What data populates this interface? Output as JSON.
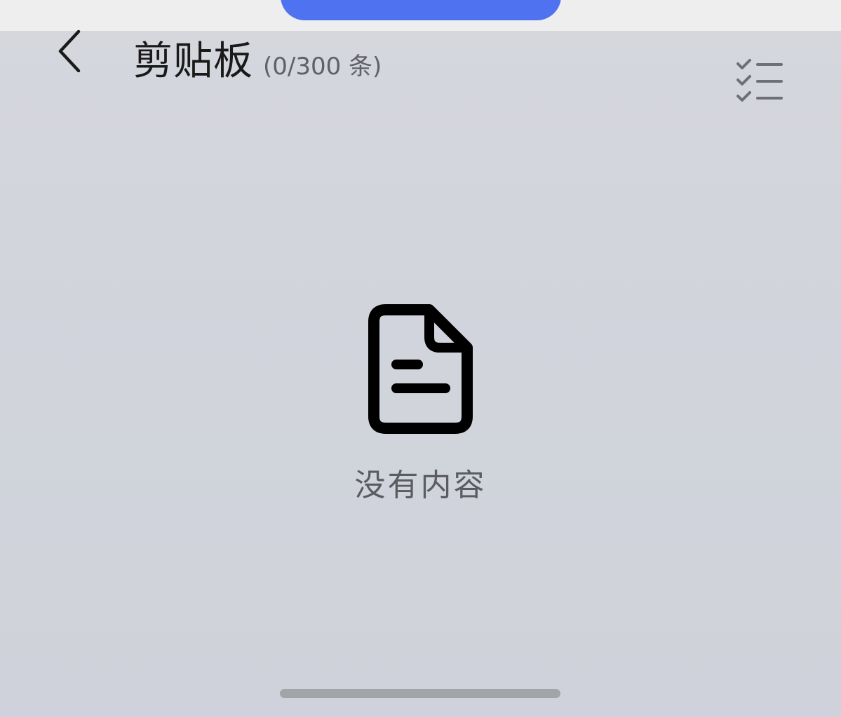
{
  "header": {
    "title": "剪贴板",
    "count": "(0/300 条)",
    "back_icon": "chevron-left-icon",
    "select_icon": "checklist-icon"
  },
  "empty_state": {
    "icon": "document-icon",
    "message": "没有内容"
  },
  "colors": {
    "accent": "#4f73f0",
    "panel_bg": "#d0d3db",
    "top_strip": "#eeeeee",
    "title_text": "#1a1a1a",
    "muted_text": "#5a5c60",
    "home_indicator": "#a3a4a7"
  }
}
